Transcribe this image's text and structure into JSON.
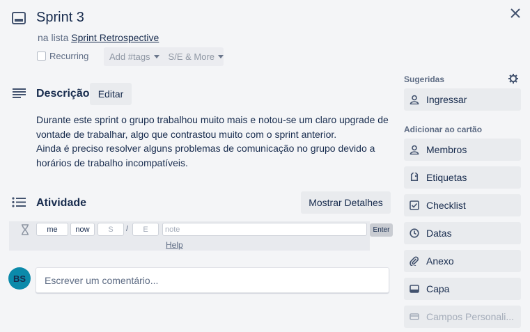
{
  "card": {
    "title": "Sprint 3",
    "list_prefix": "na lista",
    "list_name": "Sprint Retrospective",
    "recurring_label": "Recurring",
    "tags_label": "Add #tags",
    "se_label": "S/E & More"
  },
  "description": {
    "heading": "Descrição",
    "edit_label": "Editar",
    "lines": [
      "Durante este sprint o grupo trabalhou muito mais e notou-se um claro upgrade de",
      "vontade de trabalhar, algo que contrastou muito com o sprint anterior.",
      "Ainda é preciso resolver alguns problemas de comunicação no grupo devido a",
      "horários de trabalho incompatíveis."
    ]
  },
  "activity": {
    "heading": "Atividade",
    "details_label": "Mostrar Detalhes",
    "time": {
      "me": "me",
      "now": "now",
      "start_placeholder": "S",
      "separator": "/",
      "end_placeholder": "E",
      "note_placeholder": "note",
      "enter_label": "Enter",
      "help_label": "Help"
    },
    "avatar_initials": "BS",
    "comment_placeholder": "Escrever um comentário..."
  },
  "sidebar": {
    "suggested_label": "Sugeridas",
    "join_label": "Ingressar",
    "add_label": "Adicionar ao cartão",
    "items": [
      {
        "label": "Membros",
        "icon": "person-icon"
      },
      {
        "label": "Etiquetas",
        "icon": "tag-icon"
      },
      {
        "label": "Checklist",
        "icon": "checkbox-icon"
      },
      {
        "label": "Datas",
        "icon": "clock-icon"
      },
      {
        "label": "Anexo",
        "icon": "paperclip-icon"
      },
      {
        "label": "Capa",
        "icon": "card-cover-icon"
      },
      {
        "label": "Campos Personali...",
        "icon": "custom-fields-icon"
      }
    ]
  },
  "colors": {
    "background": "#f4f5f7",
    "button": "#e9ebee",
    "avatar": "#0b8aaa",
    "text": "#172b4d",
    "muted": "#5e6c84"
  }
}
